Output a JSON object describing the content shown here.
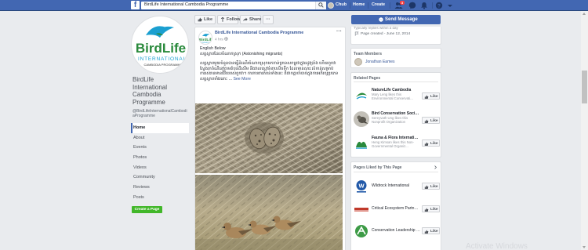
{
  "topbar": {
    "logo": "f",
    "search_value": "BirdLife International Cambodia Programme",
    "user_name": "Chub",
    "home_label": "Home",
    "create_label": "Create",
    "friend_requests_count": "3",
    "icons": [
      "search-icon",
      "friends-icon",
      "messenger-icon",
      "notifications-icon",
      "help-icon",
      "dropdown-icon"
    ]
  },
  "left": {
    "page_name": "BirdLife International Cambodia Programme",
    "handle": "@BirdLifeInternationalCambodiaProgramme",
    "nav": [
      "Home",
      "About",
      "Events",
      "Photos",
      "Videos",
      "Community",
      "Reviews",
      "Posts"
    ],
    "create_page": "Create a Page"
  },
  "actions": {
    "like": "Like",
    "follow": "Follow",
    "share": "Share",
    "more": "···",
    "send_message": "Send Message"
  },
  "post": {
    "author": "BirdLife International Cambodia Programme",
    "time": "4 hrs",
    "menu": "···",
    "english_below": "English Below",
    "khmer_text": "សត្វស្លាបដែលចំណាកស្រុក (Astonishing migrants)",
    "khmer_body": "សត្វស្លាបមួយចំនួនបានធ្វើដំណើរចំណាកស្រុកមកកាន់ប្រទេសកម្ពុជាក្នុងរដូវប្រាំង ហើយពួកវាស្វែងរកចំណីនៅតាមតំបន់ដីសើម និងវាលស្មៅទំនាបលិចទឹក ដែលមានសារៈសំខាន់សម្រាប់ការរស់រានមានជីវិតរបស់ពួកវា។ ការការពារតំបន់ទាំងនេះ គឺជាកត្តាចាំបាច់ក្នុងការអភិរក្សប្រភេទសត្វស្លាបទាំងនោះ",
    "see_more": "See More",
    "photo_alts": [
      "bird-eggs-photo",
      "pratincoles-photo"
    ]
  },
  "right": {
    "info_partial": "Typically replies within a day",
    "page_created": "Page created - June 12, 2014",
    "team_members_title": "Team Members",
    "team_member": "Jonathan Eames",
    "related_pages_title": "Related Pages",
    "related_pages": [
      {
        "name": "NatureLife Cambodia",
        "sub": "Mary Leng likes this Environmental Conservati..."
      },
      {
        "name": "Bird Conservation Society of Cambodia",
        "sub": "Sereyvath Ung likes this Nonprofit Organization"
      },
      {
        "name": "Fauna & Flora International Cambodia",
        "sub": "Heng Kimsan likes this Non-Governmental Organiz..."
      }
    ],
    "pages_liked_title": "Pages Liked by This Page",
    "pages_liked": [
      {
        "name": "Wildrock International"
      },
      {
        "name": "Critical Ecosystem Partnership Fund"
      },
      {
        "name": "Conservation Leadership Programme"
      }
    ],
    "like_label": "Like"
  },
  "watermark": "Activate Windows",
  "colors": {
    "fb_blue": "#4267b2",
    "link": "#385898",
    "green": "#42b72a",
    "background": "#e9ebee"
  }
}
